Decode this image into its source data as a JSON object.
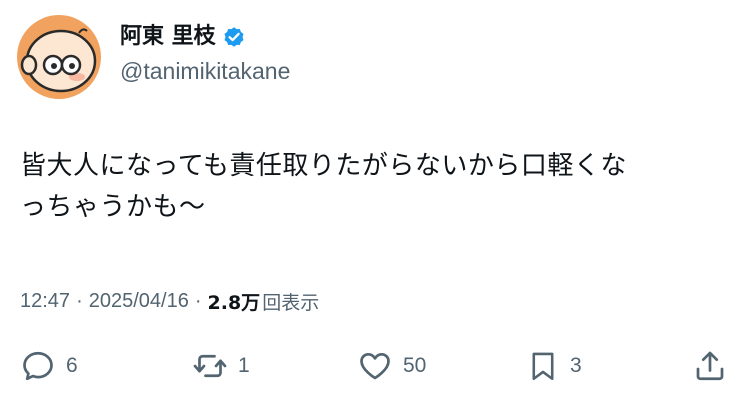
{
  "author": {
    "display_name": "阿東 里枝",
    "handle": "@tanimikitakane",
    "verified": true,
    "avatar_icon": "bald-cartoon-face-icon"
  },
  "post": {
    "text_line1": "皆大人になっても責任取りたがらないから口軽くな",
    "text_line2": "っちゃうかも〜",
    "time": "12:47",
    "date": "2025/04/16",
    "separator": "·",
    "views_count": "2.8万",
    "views_label": "回表示"
  },
  "actions": {
    "replies": "6",
    "reposts": "1",
    "likes": "50",
    "bookmarks": "3"
  },
  "colors": {
    "text": "#0f1419",
    "secondary": "#536471",
    "verified": "#1d9bf0",
    "avatar_bg": "#f4a460"
  }
}
